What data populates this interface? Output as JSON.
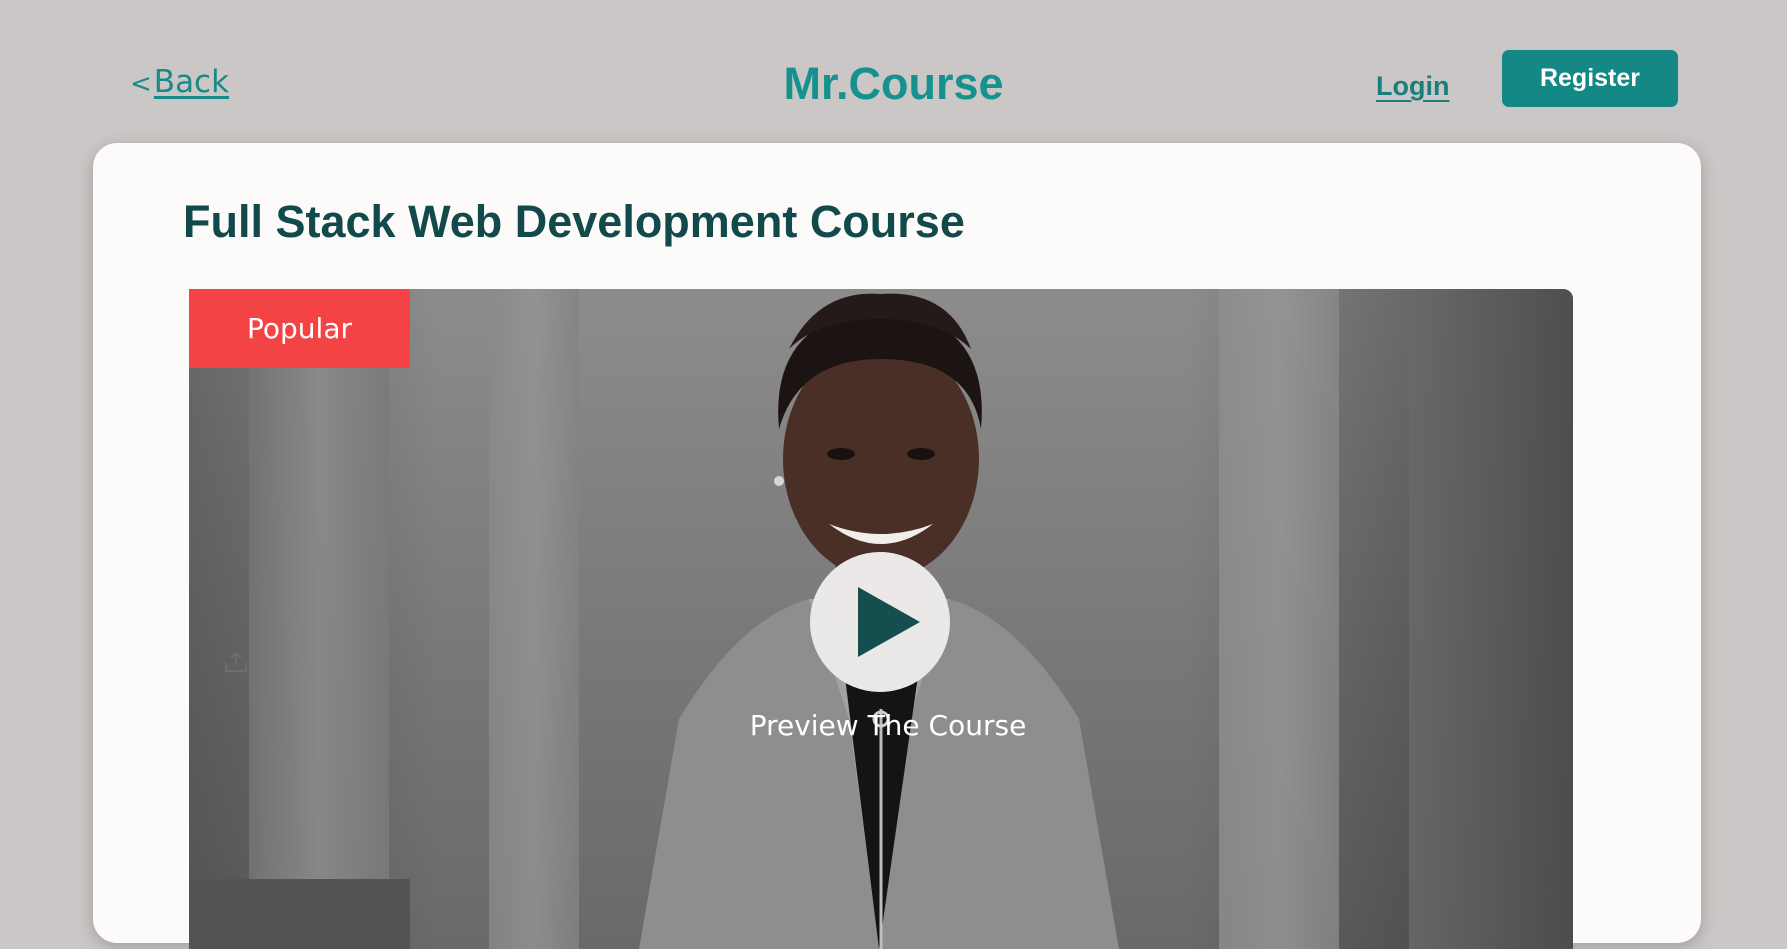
{
  "header": {
    "back_chevron": "<",
    "back_label": "Back",
    "brand": "Mr.Course",
    "login_label": "Login",
    "register_label": "Register"
  },
  "course": {
    "title": "Full Stack Web Development Course",
    "badge": "Popular",
    "preview_label": "Preview The Course"
  },
  "icons": {
    "play": "play-icon",
    "share": "share-icon",
    "back": "chevron-left-icon"
  },
  "colors": {
    "page_bg": "#cbc7c6",
    "brand": "#15918e",
    "primary_button": "#148885",
    "title": "#124a4c",
    "badge": "#f44345",
    "card_bg": "#fcfbfa"
  }
}
